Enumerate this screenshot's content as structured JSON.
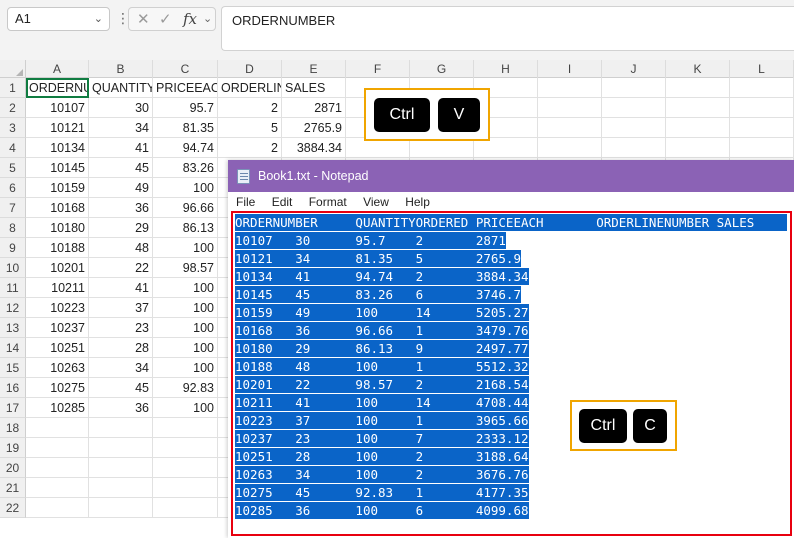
{
  "formula_bar": {
    "name_box": "A1",
    "dots": "⋮",
    "cancel_glyph": "✕",
    "enter_glyph": "✓",
    "fx_glyph": "fx",
    "chevron": "⌄",
    "formula": "ORDERNUMBER"
  },
  "sheet": {
    "columns": [
      "A",
      "B",
      "C",
      "D",
      "E",
      "F",
      "G",
      "H",
      "I",
      "J",
      "K",
      "L"
    ],
    "row_numbers": [
      "1",
      "2",
      "3",
      "4",
      "5",
      "6",
      "7",
      "8",
      "9",
      "10",
      "11",
      "12",
      "13",
      "14",
      "15",
      "16",
      "17",
      "18",
      "19",
      "20",
      "21",
      "22"
    ],
    "header_row": [
      "ORDERNUMBER",
      "QUANTITYORDERED",
      "PRICEEACH",
      "ORDERLINENUMBER",
      "SALES"
    ],
    "rows": [
      [
        "10107",
        "30",
        "95.7",
        "2",
        "2871"
      ],
      [
        "10121",
        "34",
        "81.35",
        "5",
        "2765.9"
      ],
      [
        "10134",
        "41",
        "94.74",
        "2",
        "3884.34"
      ],
      [
        "10145",
        "45",
        "83.26"
      ],
      [
        "10159",
        "49",
        "100"
      ],
      [
        "10168",
        "36",
        "96.66"
      ],
      [
        "10180",
        "29",
        "86.13"
      ],
      [
        "10188",
        "48",
        "100"
      ],
      [
        "10201",
        "22",
        "98.57"
      ],
      [
        "10211",
        "41",
        "100"
      ],
      [
        "10223",
        "37",
        "100"
      ],
      [
        "10237",
        "23",
        "100"
      ],
      [
        "10251",
        "28",
        "100"
      ],
      [
        "10263",
        "34",
        "100"
      ],
      [
        "10275",
        "45",
        "92.83"
      ],
      [
        "10285",
        "36",
        "100"
      ]
    ]
  },
  "paste_keys": {
    "ctrl": "Ctrl",
    "key": "V"
  },
  "copy_keys": {
    "ctrl": "Ctrl",
    "key": "C"
  },
  "colors": {
    "badge_border": "#f0a500",
    "notepad_title_bg": "#8b62b5",
    "selection": "#0a64c8",
    "editor_border": "#e8000f"
  },
  "notepad": {
    "title": "Book1.txt - Notepad",
    "menu": [
      "File",
      "Edit",
      "Format",
      "View",
      "Help"
    ],
    "lines": [
      "ORDERNUMBER\tQUANTITYORDERED\tPRICEEACH\tORDERLINENUMBER\tSALES",
      "10107\t30\t95.7\t2\t2871",
      "10121\t34\t81.35\t5\t2765.9",
      "10134\t41\t94.74\t2\t3884.34",
      "10145\t45\t83.26\t6\t3746.7",
      "10159\t49\t100\t14\t5205.27",
      "10168\t36\t96.66\t1\t3479.76",
      "10180\t29\t86.13\t9\t2497.77",
      "10188\t48\t100\t1\t5512.32",
      "10201\t22\t98.57\t2\t2168.54",
      "10211\t41\t100\t14\t4708.44",
      "10223\t37\t100\t1\t3965.66",
      "10237\t23\t100\t7\t2333.12",
      "10251\t28\t100\t2\t3188.64",
      "10263\t34\t100\t2\t3676.76",
      "10275\t45\t92.83\t1\t4177.35",
      "10285\t36\t100\t6\t4099.68"
    ]
  }
}
